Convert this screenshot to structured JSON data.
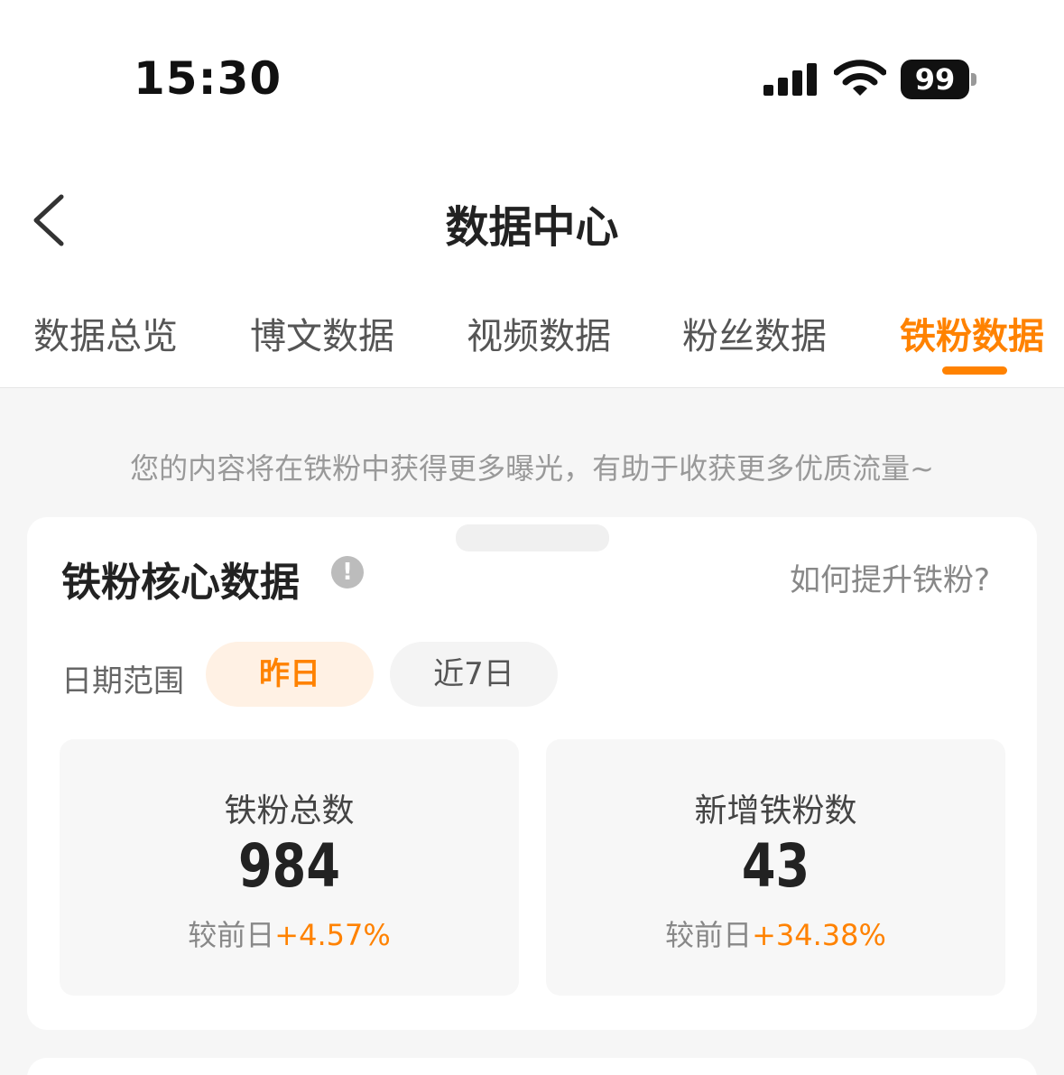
{
  "status_bar": {
    "time": "15:30",
    "battery": "99"
  },
  "nav": {
    "title": "数据中心"
  },
  "tabs": [
    {
      "label": "数据总览",
      "active": false
    },
    {
      "label": "博文数据",
      "active": false
    },
    {
      "label": "视频数据",
      "active": false
    },
    {
      "label": "粉丝数据",
      "active": false
    },
    {
      "label": "铁粉数据",
      "active": true
    }
  ],
  "notice": "您的内容将在铁粉中获得更多曝光，有助于收获更多优质流量~",
  "core_card": {
    "title": "铁粉核心数据",
    "help_link": "如何提升铁粉?",
    "range_label": "日期范围",
    "range_options": [
      "昨日",
      "近7日"
    ],
    "selected_range": "昨日",
    "stats": [
      {
        "label": "铁粉总数",
        "value": "984",
        "compare_prefix": "较前日",
        "compare_value": "+4.57%"
      },
      {
        "label": "新增铁粉数",
        "value": "43",
        "compare_prefix": "较前日",
        "compare_value": "+34.38%"
      }
    ]
  },
  "colors": {
    "accent": "#ff8200",
    "accent_bg": "#fff1e4",
    "page_bg": "#f6f6f6"
  }
}
